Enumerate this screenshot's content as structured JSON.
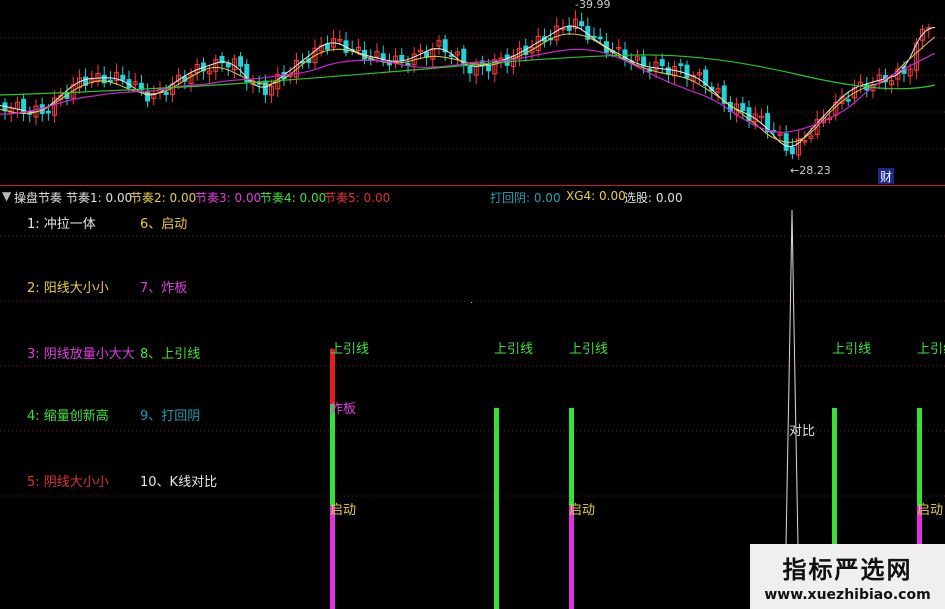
{
  "main_chart": {
    "price_high_label": "39.99",
    "price_low_label": "28.23",
    "finance_badge": "财",
    "colors": {
      "up": "#ff3b3b",
      "down": "#22d3d8",
      "ma_white": "#eeeeee",
      "ma_yellow": "#e8c840",
      "ma_magenta": "#d020d0",
      "ma_green": "#28c828"
    }
  },
  "indicator_header": {
    "name": "操盘节奏",
    "items": [
      {
        "label": "节奏1: 0.00",
        "color": "#e0e0e0"
      },
      {
        "label": "节奏2: 0.00",
        "color": "#e8d040"
      },
      {
        "label": "节奏3: 0.00",
        "color": "#e040e0"
      },
      {
        "label": "节奏4: 0.00",
        "color": "#40e040"
      },
      {
        "label": "节奏5: 0.00",
        "color": "#e03030"
      },
      {
        "label": "打回阴: 0.00",
        "color": "#20a0b0"
      },
      {
        "label": "XG4: 0.00",
        "color": "#e8d040"
      },
      {
        "label": "选股: 0.00",
        "color": "#e0e0e0"
      }
    ]
  },
  "legend": {
    "left": [
      {
        "label": "1: 冲拉一体",
        "color": "#e6e6e6"
      },
      {
        "label": "2: 阳线大小小",
        "color": "#e8d040"
      },
      {
        "label": "3: 阴线放量小大大",
        "color": "#e040e0"
      },
      {
        "label": "4: 缩量创新高",
        "color": "#40e040"
      },
      {
        "label": "5: 阴线大小小",
        "color": "#e03030"
      }
    ],
    "right": [
      {
        "label": "6、启动",
        "color": "#e8d040"
      },
      {
        "label": "7、炸板",
        "color": "#e040e0"
      },
      {
        "label": "8、上引线",
        "color": "#40e040"
      },
      {
        "label": "9、打回阴",
        "color": "#20a0b0"
      },
      {
        "label": "10、K线对比",
        "color": "#e6e6e6"
      }
    ]
  },
  "signals": {
    "label_shang_yin_xian": "上引线",
    "label_zha_ban": "炸板",
    "label_qi_dong": "启动",
    "label_dui_bi": "对比",
    "colors": {
      "green": "#36e036",
      "red": "#e02020",
      "magenta": "#e030e0",
      "white": "#dddddd",
      "label_green": "#40e040",
      "label_magenta": "#e040e0",
      "label_yellow": "#e8d040",
      "label_white": "#dddddd"
    }
  },
  "watermark": {
    "title": "指标严选网",
    "url": "www.xuezhibiao.com"
  }
}
